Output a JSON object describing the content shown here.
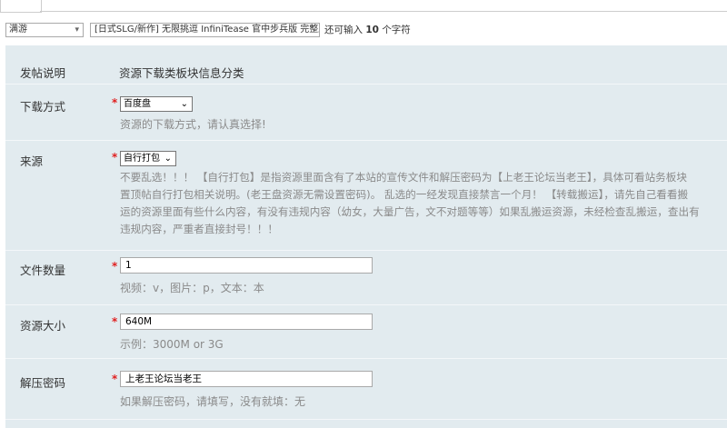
{
  "header": {
    "post_type": "满游",
    "title_value": "[日式SLG/新作] 无限挑逗 InfiniTease 官中步兵版 完整版",
    "hint_prefix": "还可输入",
    "hint_count": "10",
    "hint_suffix": "个字符"
  },
  "form": {
    "post_desc": {
      "label": "发帖说明",
      "value": "资源下载类板块信息分类"
    },
    "download_method": {
      "label": "下载方式",
      "required": "*",
      "selected": "百度盘",
      "hint": "资源的下载方式，请认真选择!"
    },
    "source": {
      "label": "来源",
      "required": "*",
      "selected": "自行打包",
      "hint_lines": [
        "不要乱选！！！ 【自行打包】是指资源里面含有了本站的宣传文件和解压密码为【上老王论坛当老王】，具体可看站务板块",
        "置顶帖自行打包相关说明。(老王盘资源无需设置密码)。 乱选的一经发现直接禁言一个月！ 【转载搬运】，请先自己看看搬",
        "运的资源里面有些什么内容，有没有违规内容（幼女，大量广告，文不对题等等）如果乱搬运资源，未经检查乱搬运，查出有",
        "违规内容，严重者直接封号！！！"
      ]
    },
    "file_count": {
      "label": "文件数量",
      "required": "*",
      "value": "1",
      "hint": "视频：v，图片：p，文本：本"
    },
    "resource_size": {
      "label": "资源大小",
      "required": "*",
      "value": "640M",
      "hint": "示例：3000M or 3G"
    },
    "unzip_password": {
      "label": "解压密码",
      "required": "*",
      "value": "上老王论坛当老王",
      "hint": "如果解压密码，请填写，没有就填：无"
    }
  }
}
